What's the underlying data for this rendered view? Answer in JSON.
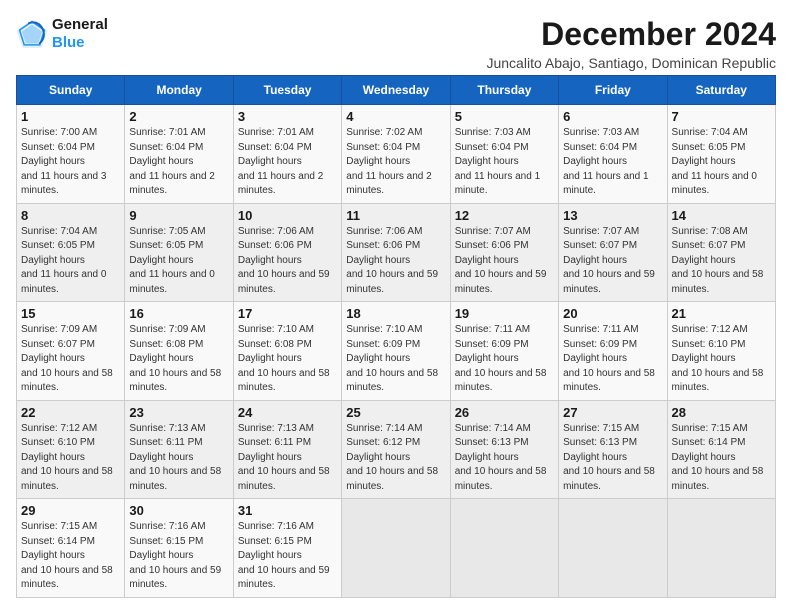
{
  "header": {
    "logo_line1": "General",
    "logo_line2": "Blue",
    "month": "December 2024",
    "location": "Juncalito Abajo, Santiago, Dominican Republic"
  },
  "weekdays": [
    "Sunday",
    "Monday",
    "Tuesday",
    "Wednesday",
    "Thursday",
    "Friday",
    "Saturday"
  ],
  "weeks": [
    [
      {
        "day": "1",
        "sunrise": "7:00 AM",
        "sunset": "6:04 PM",
        "daylight": "11 hours and 3 minutes."
      },
      {
        "day": "2",
        "sunrise": "7:01 AM",
        "sunset": "6:04 PM",
        "daylight": "11 hours and 2 minutes."
      },
      {
        "day": "3",
        "sunrise": "7:01 AM",
        "sunset": "6:04 PM",
        "daylight": "11 hours and 2 minutes."
      },
      {
        "day": "4",
        "sunrise": "7:02 AM",
        "sunset": "6:04 PM",
        "daylight": "11 hours and 2 minutes."
      },
      {
        "day": "5",
        "sunrise": "7:03 AM",
        "sunset": "6:04 PM",
        "daylight": "11 hours and 1 minute."
      },
      {
        "day": "6",
        "sunrise": "7:03 AM",
        "sunset": "6:04 PM",
        "daylight": "11 hours and 1 minute."
      },
      {
        "day": "7",
        "sunrise": "7:04 AM",
        "sunset": "6:05 PM",
        "daylight": "11 hours and 0 minutes."
      }
    ],
    [
      {
        "day": "8",
        "sunrise": "7:04 AM",
        "sunset": "6:05 PM",
        "daylight": "11 hours and 0 minutes."
      },
      {
        "day": "9",
        "sunrise": "7:05 AM",
        "sunset": "6:05 PM",
        "daylight": "11 hours and 0 minutes."
      },
      {
        "day": "10",
        "sunrise": "7:06 AM",
        "sunset": "6:06 PM",
        "daylight": "10 hours and 59 minutes."
      },
      {
        "day": "11",
        "sunrise": "7:06 AM",
        "sunset": "6:06 PM",
        "daylight": "10 hours and 59 minutes."
      },
      {
        "day": "12",
        "sunrise": "7:07 AM",
        "sunset": "6:06 PM",
        "daylight": "10 hours and 59 minutes."
      },
      {
        "day": "13",
        "sunrise": "7:07 AM",
        "sunset": "6:07 PM",
        "daylight": "10 hours and 59 minutes."
      },
      {
        "day": "14",
        "sunrise": "7:08 AM",
        "sunset": "6:07 PM",
        "daylight": "10 hours and 58 minutes."
      }
    ],
    [
      {
        "day": "15",
        "sunrise": "7:09 AM",
        "sunset": "6:07 PM",
        "daylight": "10 hours and 58 minutes."
      },
      {
        "day": "16",
        "sunrise": "7:09 AM",
        "sunset": "6:08 PM",
        "daylight": "10 hours and 58 minutes."
      },
      {
        "day": "17",
        "sunrise": "7:10 AM",
        "sunset": "6:08 PM",
        "daylight": "10 hours and 58 minutes."
      },
      {
        "day": "18",
        "sunrise": "7:10 AM",
        "sunset": "6:09 PM",
        "daylight": "10 hours and 58 minutes."
      },
      {
        "day": "19",
        "sunrise": "7:11 AM",
        "sunset": "6:09 PM",
        "daylight": "10 hours and 58 minutes."
      },
      {
        "day": "20",
        "sunrise": "7:11 AM",
        "sunset": "6:09 PM",
        "daylight": "10 hours and 58 minutes."
      },
      {
        "day": "21",
        "sunrise": "7:12 AM",
        "sunset": "6:10 PM",
        "daylight": "10 hours and 58 minutes."
      }
    ],
    [
      {
        "day": "22",
        "sunrise": "7:12 AM",
        "sunset": "6:10 PM",
        "daylight": "10 hours and 58 minutes."
      },
      {
        "day": "23",
        "sunrise": "7:13 AM",
        "sunset": "6:11 PM",
        "daylight": "10 hours and 58 minutes."
      },
      {
        "day": "24",
        "sunrise": "7:13 AM",
        "sunset": "6:11 PM",
        "daylight": "10 hours and 58 minutes."
      },
      {
        "day": "25",
        "sunrise": "7:14 AM",
        "sunset": "6:12 PM",
        "daylight": "10 hours and 58 minutes."
      },
      {
        "day": "26",
        "sunrise": "7:14 AM",
        "sunset": "6:13 PM",
        "daylight": "10 hours and 58 minutes."
      },
      {
        "day": "27",
        "sunrise": "7:15 AM",
        "sunset": "6:13 PM",
        "daylight": "10 hours and 58 minutes."
      },
      {
        "day": "28",
        "sunrise": "7:15 AM",
        "sunset": "6:14 PM",
        "daylight": "10 hours and 58 minutes."
      }
    ],
    [
      {
        "day": "29",
        "sunrise": "7:15 AM",
        "sunset": "6:14 PM",
        "daylight": "10 hours and 58 minutes."
      },
      {
        "day": "30",
        "sunrise": "7:16 AM",
        "sunset": "6:15 PM",
        "daylight": "10 hours and 59 minutes."
      },
      {
        "day": "31",
        "sunrise": "7:16 AM",
        "sunset": "6:15 PM",
        "daylight": "10 hours and 59 minutes."
      },
      null,
      null,
      null,
      null
    ]
  ]
}
